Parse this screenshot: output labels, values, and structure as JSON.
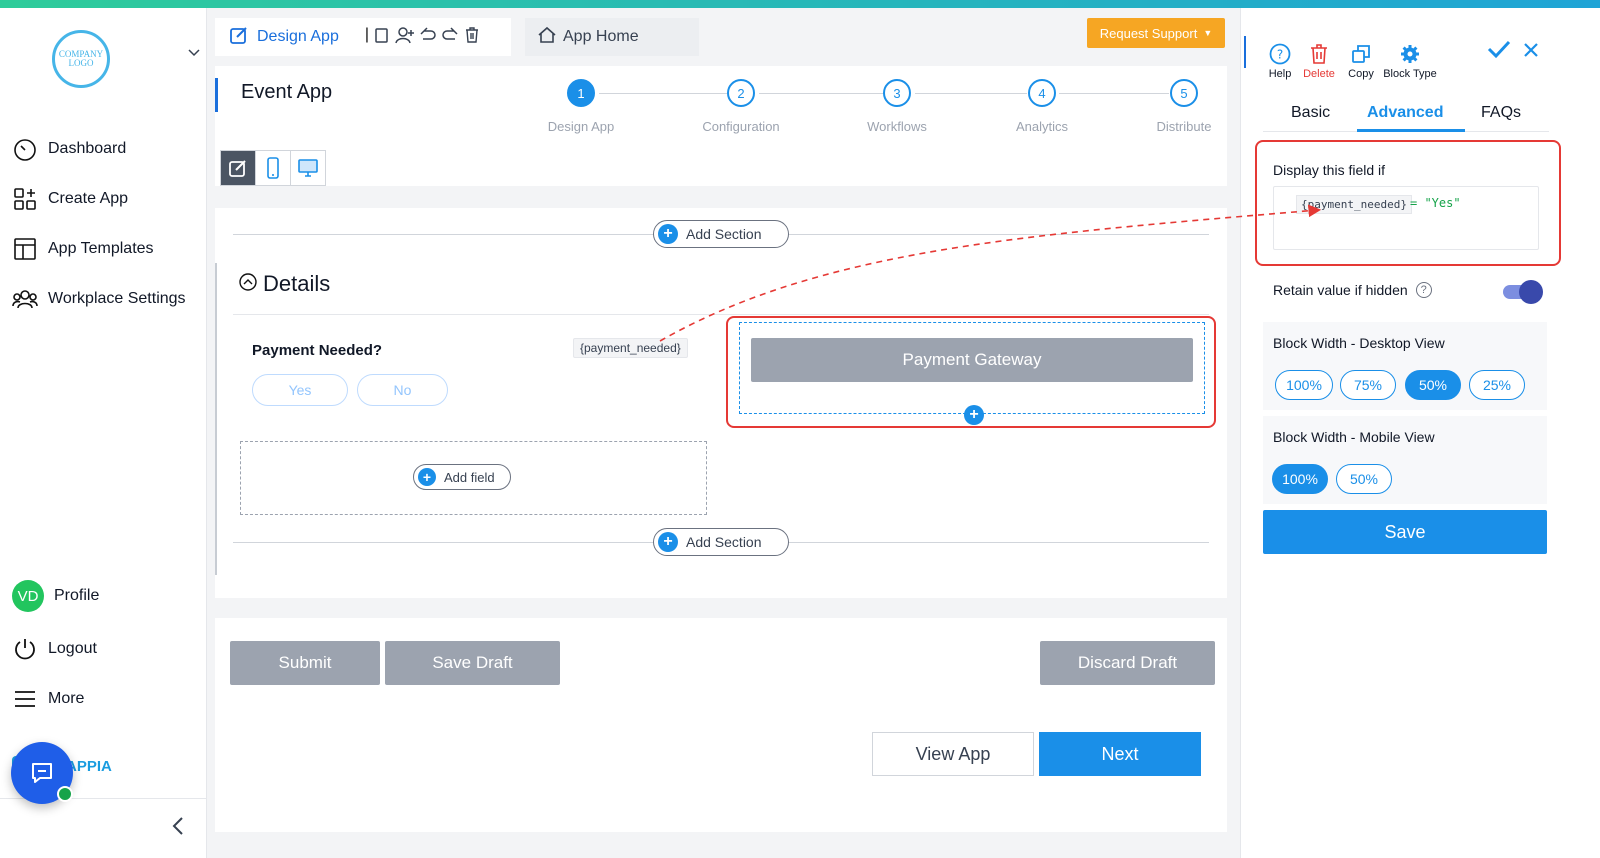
{
  "sidebar": {
    "logo_text": "COMPANY LOGO",
    "items": [
      {
        "label": "Dashboard",
        "icon": "dashboard-icon"
      },
      {
        "label": "Create App",
        "icon": "create-app-icon"
      },
      {
        "label": "App Templates",
        "icon": "templates-icon"
      },
      {
        "label": "Workplace Settings",
        "icon": "users-gear-icon"
      }
    ],
    "profile": {
      "initials": "VD",
      "label": "Profile"
    },
    "logout": "Logout",
    "more": "More",
    "brand": "APPIA"
  },
  "topbar": {
    "design_tab": "Design App",
    "home_tab": "App Home",
    "request_support": "Request Support"
  },
  "header": {
    "app_name": "Event App",
    "steps": [
      {
        "num": "1",
        "label": "Design App"
      },
      {
        "num": "2",
        "label": "Configuration"
      },
      {
        "num": "3",
        "label": "Workflows"
      },
      {
        "num": "4",
        "label": "Analytics"
      },
      {
        "num": "5",
        "label": "Distribute"
      }
    ]
  },
  "canvas": {
    "add_section": "Add Section",
    "section_title": "Details",
    "field_label": "Payment Needed?",
    "field_var": "{payment_needed}",
    "yes": "Yes",
    "no": "No",
    "add_field": "Add field",
    "payment_gateway": "Payment Gateway"
  },
  "footer": {
    "submit": "Submit",
    "save_draft": "Save Draft",
    "discard_draft": "Discard Draft",
    "view_app": "View App",
    "next": "Next"
  },
  "panel": {
    "tools": [
      {
        "label": "Help",
        "color": "#111827"
      },
      {
        "label": "Delete",
        "color": "#e53935"
      },
      {
        "label": "Copy",
        "color": "#111827"
      },
      {
        "label": "Block Type",
        "color": "#111827"
      }
    ],
    "tabs": [
      "Basic",
      "Advanced",
      "FAQs"
    ],
    "active_tab": "Advanced",
    "condition_title": "Display this field if",
    "condition_var": "{payment_needed}",
    "condition_expr": "= \"Yes\"",
    "retain_label": "Retain value if hidden",
    "retain_on": true,
    "desktop_width_title": "Block Width - Desktop View",
    "desktop_options": [
      "100%",
      "75%",
      "50%",
      "25%"
    ],
    "desktop_selected": "50%",
    "mobile_width_title": "Block Width - Mobile View",
    "mobile_options": [
      "100%",
      "50%"
    ],
    "mobile_selected": "100%",
    "save": "Save"
  },
  "colors": {
    "accent": "#1a8fe8",
    "highlight": "#e53935",
    "support": "#f6a623"
  }
}
